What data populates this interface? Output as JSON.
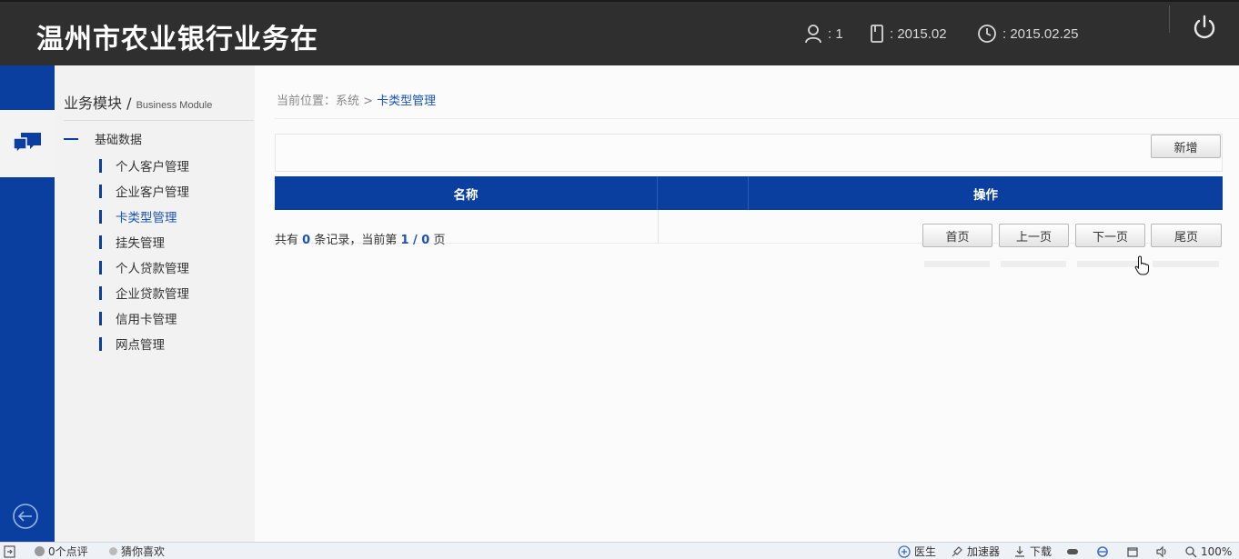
{
  "header": {
    "title": "温州市农业银行业务在",
    "user_count": "1",
    "month": "2015.02",
    "date": "2015.02.25"
  },
  "sidebar": {
    "module_title": "业务模块",
    "module_sub": "Business Module",
    "group_label": "基础数据",
    "items": [
      {
        "label": "个人客户管理"
      },
      {
        "label": "企业客户管理"
      },
      {
        "label": "卡类型管理"
      },
      {
        "label": "挂失管理"
      },
      {
        "label": "个人贷款管理"
      },
      {
        "label": "企业贷款管理"
      },
      {
        "label": "信用卡管理"
      },
      {
        "label": "网点管理"
      }
    ],
    "active_index": 2
  },
  "breadcrumb": {
    "prefix": "当前位置：系统 > ",
    "current": "卡类型管理"
  },
  "toolbar": {
    "add_label": "新增"
  },
  "table": {
    "columns": [
      "名称",
      "操作"
    ]
  },
  "pager": {
    "total_prefix": "共有 ",
    "total": "0",
    "total_suffix": " 条记录，当前第 ",
    "current": "1 / 0",
    "page_suffix": " 页",
    "first": "首页",
    "prev": "上一页",
    "next": "下一页",
    "last": "尾页"
  },
  "statusbar": {
    "reviews": "0个点评",
    "guess": "猜你喜欢",
    "doctor": "医生",
    "accelerator": "加速器",
    "download": "下载",
    "zoom": "100%"
  },
  "colors": {
    "header_bg": "#2f2f2f",
    "brand_blue": "#0a3fa0",
    "link_blue": "#1a52b5",
    "sidebar_bg": "#f2f2f2"
  }
}
